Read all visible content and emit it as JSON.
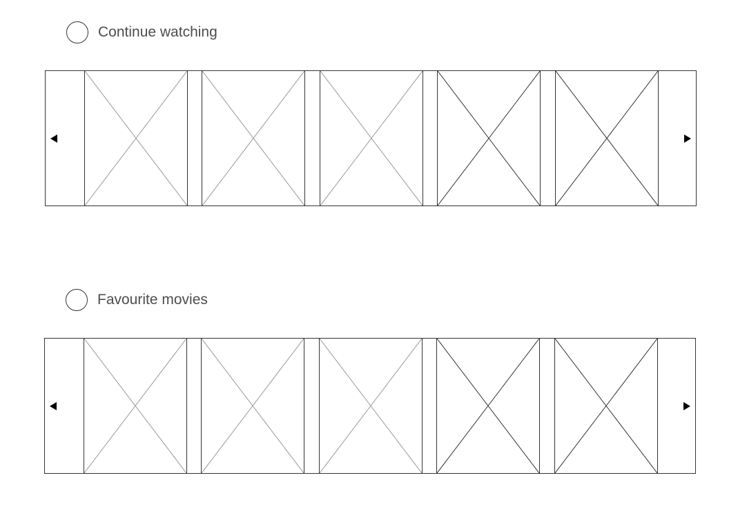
{
  "sections": [
    {
      "title": "Continue watching",
      "tiles": [
        {
          "icon": "image-placeholder-icon",
          "shade": "light"
        },
        {
          "icon": "image-placeholder-icon",
          "shade": "light"
        },
        {
          "icon": "image-placeholder-icon",
          "shade": "light"
        },
        {
          "icon": "image-placeholder-icon",
          "shade": "dark"
        },
        {
          "icon": "image-placeholder-icon",
          "shade": "dark"
        }
      ]
    },
    {
      "title": "Favourite movies",
      "tiles": [
        {
          "icon": "image-placeholder-icon",
          "shade": "light"
        },
        {
          "icon": "image-placeholder-icon",
          "shade": "light"
        },
        {
          "icon": "image-placeholder-icon",
          "shade": "light"
        },
        {
          "icon": "image-placeholder-icon",
          "shade": "dark"
        },
        {
          "icon": "image-placeholder-icon",
          "shade": "dark"
        }
      ]
    }
  ],
  "colors": {
    "border": "#333333",
    "title": "#4d4d4d",
    "cross_light": "#999999",
    "cross_dark": "#333333",
    "arrow": "#000000"
  },
  "icons": {
    "previous": "triangle-left-icon",
    "next": "triangle-right-icon",
    "section": "circle-icon"
  }
}
